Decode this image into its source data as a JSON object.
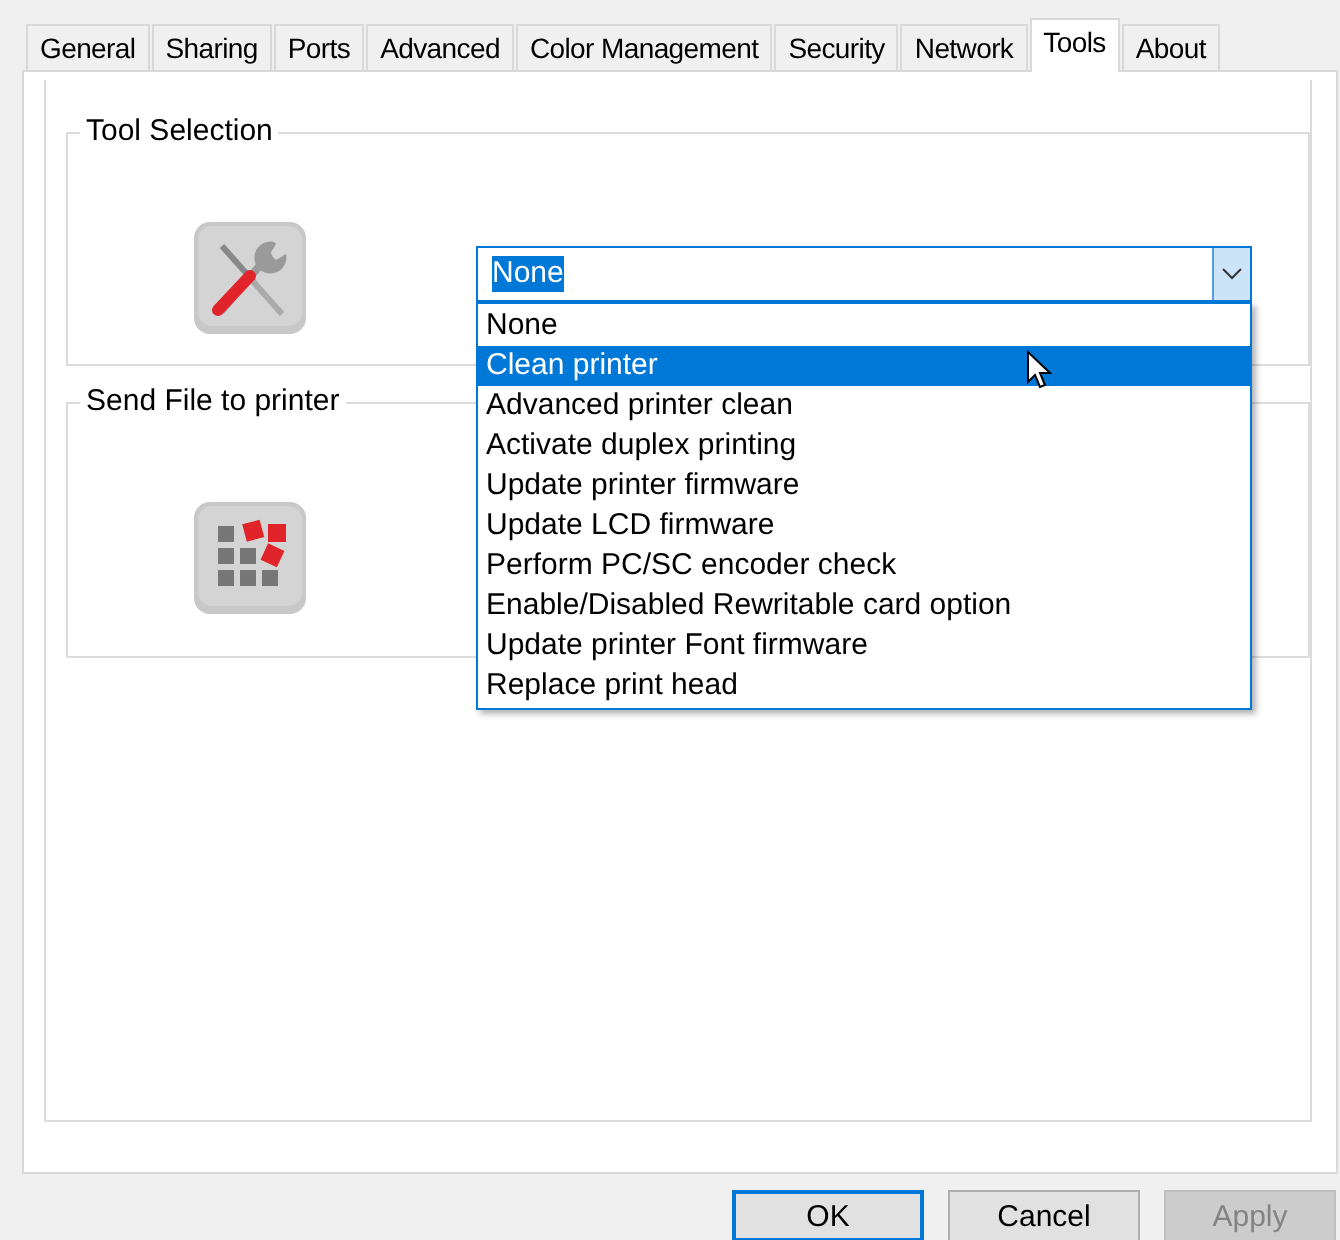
{
  "tabs": [
    {
      "label": "General",
      "selected": false
    },
    {
      "label": "Sharing",
      "selected": false
    },
    {
      "label": "Ports",
      "selected": false
    },
    {
      "label": "Advanced",
      "selected": false
    },
    {
      "label": "Color Management",
      "selected": false
    },
    {
      "label": "Security",
      "selected": false
    },
    {
      "label": "Network",
      "selected": false
    },
    {
      "label": "Tools",
      "selected": true
    },
    {
      "label": "About",
      "selected": false
    }
  ],
  "tool_selection": {
    "title": "Tool Selection",
    "dropdown": {
      "value": "None",
      "expanded": true,
      "options": [
        {
          "label": "None",
          "highlighted": false
        },
        {
          "label": "Clean printer",
          "highlighted": true
        },
        {
          "label": "Advanced printer clean",
          "highlighted": false
        },
        {
          "label": "Activate duplex printing",
          "highlighted": false
        },
        {
          "label": "Update printer firmware",
          "highlighted": false
        },
        {
          "label": "Update LCD firmware",
          "highlighted": false
        },
        {
          "label": "Perform PC/SC encoder check",
          "highlighted": false
        },
        {
          "label": "Enable/Disabled Rewritable card option",
          "highlighted": false
        },
        {
          "label": "Update printer Font firmware",
          "highlighted": false
        },
        {
          "label": "Replace print head",
          "highlighted": false
        }
      ]
    }
  },
  "send_file": {
    "title": "Send File to printer"
  },
  "buttons": [
    {
      "label": "OK",
      "disabled": false,
      "default": true
    },
    {
      "label": "Cancel",
      "disabled": false,
      "default": false
    },
    {
      "label": "Apply",
      "disabled": true,
      "default": false
    }
  ]
}
